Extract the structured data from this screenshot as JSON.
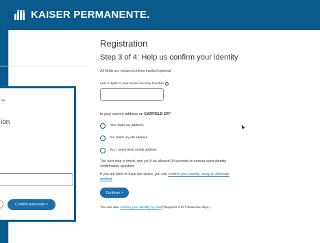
{
  "header": {
    "brand": "KAISER PERMANENTE.",
    "bg_color": "#0a5a8c"
  },
  "main": {
    "title": "Registration",
    "step": "Step 3 of 4: Help us confirm your identity",
    "required_note": "All fields are required unless marked optional",
    "ssn_label": "Last 4 digits of your Social Security Number",
    "ssn_value": "",
    "address_question_prefix": "Is your current address on ",
    "address_street": "GARFIELD DR",
    "address_question_suffix": "?",
    "options": [
      {
        "label": "Yes, that's my address."
      },
      {
        "label": "No, that's my old address."
      },
      {
        "label": "No, I never lived at that address."
      }
    ],
    "timed_note": "The next step is timed, and you'll be allowed 90 seconds to answer each identity confirmation question.",
    "low_vision_prefix": "If you are blind or have low vision, you can ",
    "low_vision_link": "confirm your identity using an alternate method",
    "low_vision_suffix": ".",
    "continue_label": "Continue >",
    "mail_prefix": "You can also ",
    "mail_link": "confirm your identity by mail",
    "mail_suffix": " (Requires 3 to 7 business days.)."
  },
  "overlay": {
    "text_line": "nal.",
    "heading_fragment": "ion",
    "input_value": "",
    "button_label": "Confirm passcode >"
  },
  "colors": {
    "accent": "#0a5a8c",
    "button": "#1a6fa8",
    "link": "#1a73b5"
  }
}
